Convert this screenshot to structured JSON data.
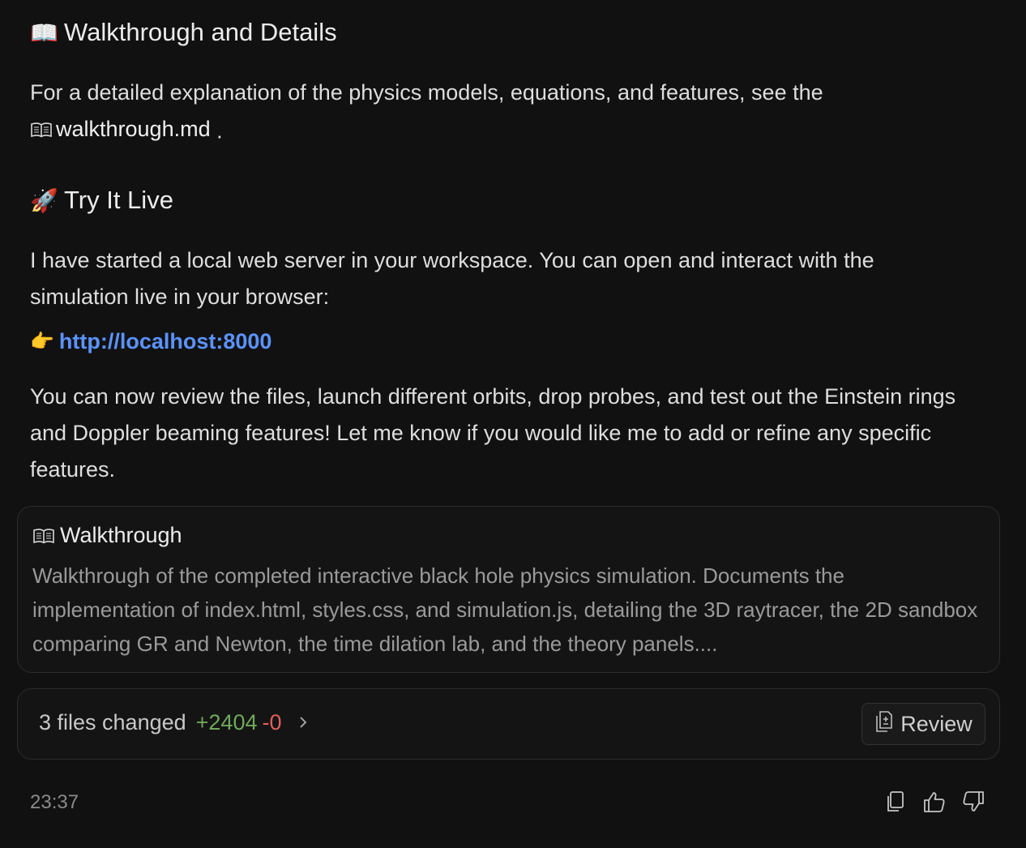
{
  "section_walkthrough": {
    "emoji": "📖",
    "title": "Walkthrough and Details",
    "text_before": "For a detailed explanation of the physics models, equations, and features, see the",
    "file_name": "walkthrough.md",
    "text_after": " ."
  },
  "section_live": {
    "emoji": "🚀",
    "title": "Try It Live",
    "intro": "I have started a local web server in your workspace. You can open and interact with the simulation live in your browser:",
    "pointer_emoji": "👉",
    "url": "http://localhost:8000",
    "followup": "You can now review the files, launch different orbits, drop probes, and test out the Einstein rings and Doppler beaming features! Let me know if you would like me to add or refine any specific features."
  },
  "artifact_card": {
    "icon": "book-icon",
    "title": "Walkthrough",
    "description": "Walkthrough of the completed interactive black hole physics simulation. Documents the implementation of index.html, styles.css, and simulation.js, detailing the 3D raytracer, the 2D sandbox comparing GR and Newton, the time dilation lab, and the theory panels...."
  },
  "changes": {
    "summary": "3 files changed",
    "added": "+2404",
    "removed": "-0",
    "review_label": "Review"
  },
  "footer": {
    "timestamp": "23:37",
    "actions": [
      "copy-icon",
      "thumbs-up-icon",
      "thumbs-down-icon"
    ]
  },
  "colors": {
    "background": "#111111",
    "link": "#5b93ff",
    "added": "#6fa85a",
    "removed": "#e0605c"
  }
}
